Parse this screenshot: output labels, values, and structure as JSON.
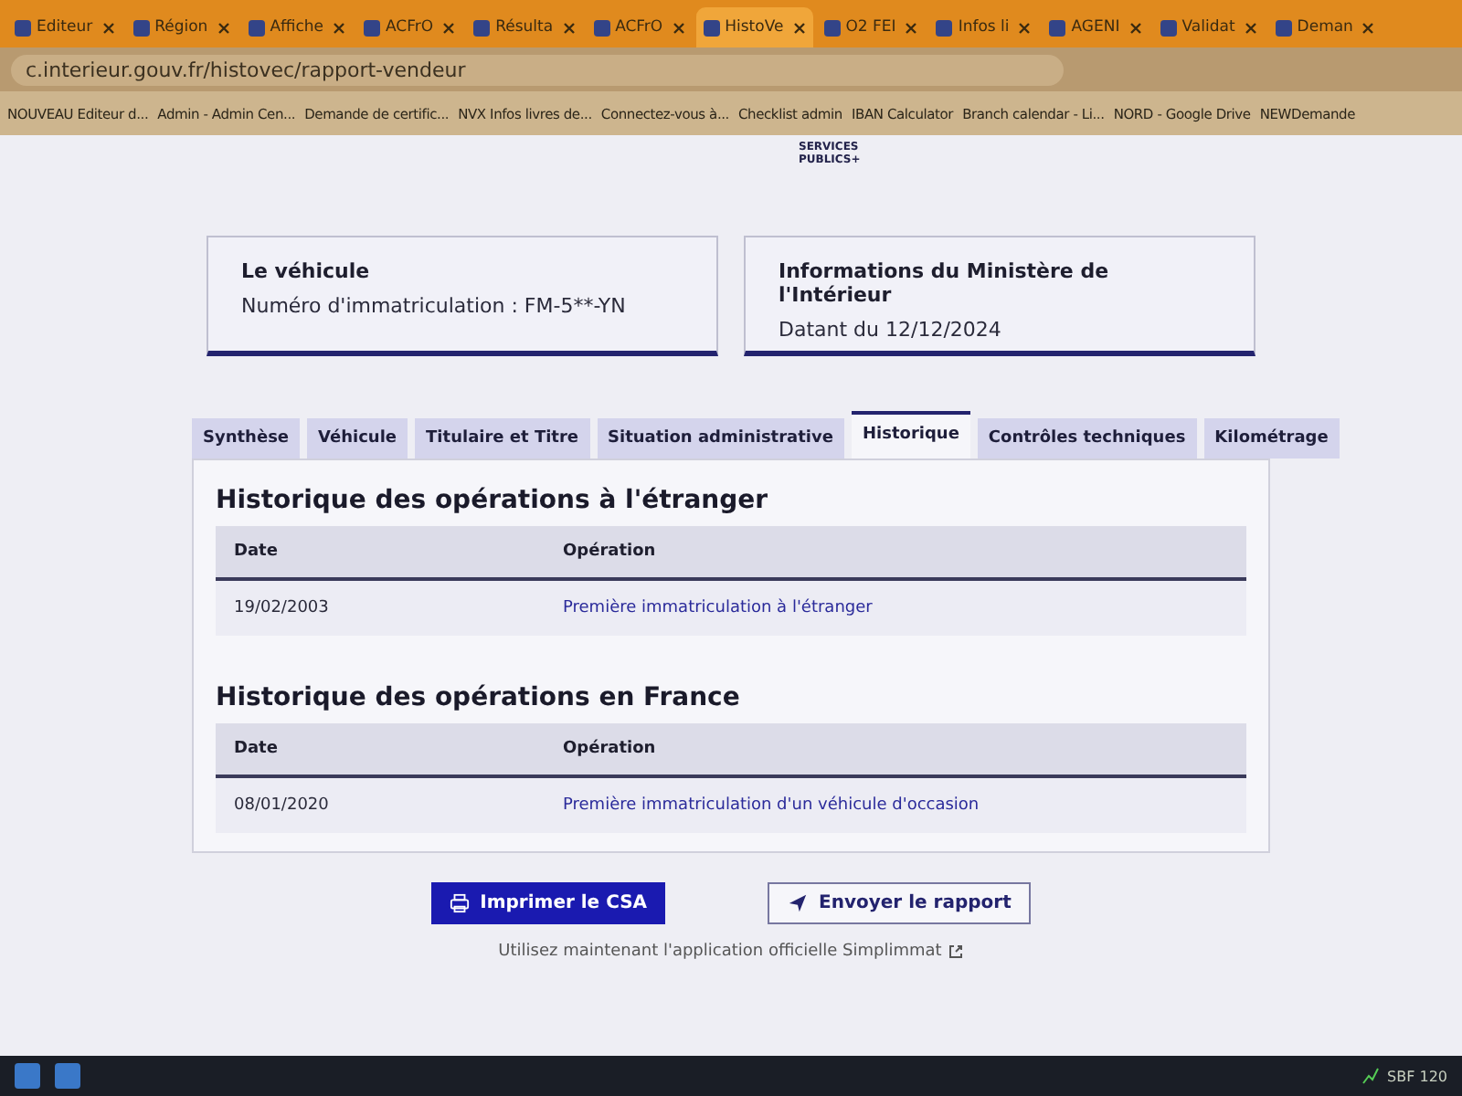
{
  "browser": {
    "tabs": [
      {
        "label": "Editeur",
        "selected": false
      },
      {
        "label": "Région",
        "selected": false
      },
      {
        "label": "Affiche",
        "selected": false
      },
      {
        "label": "ACFrO",
        "selected": false
      },
      {
        "label": "Résulta",
        "selected": false
      },
      {
        "label": "ACFrO",
        "selected": false
      },
      {
        "label": "HistoVe",
        "selected": true
      },
      {
        "label": "O2 FEI",
        "selected": false
      },
      {
        "label": "Infos li",
        "selected": false
      },
      {
        "label": "AGENI",
        "selected": false
      },
      {
        "label": "Validat",
        "selected": false
      },
      {
        "label": "Deman",
        "selected": false
      }
    ],
    "address": "c.interieur.gouv.fr/histovec/rapport-vendeur",
    "bookmarks": [
      "NOUVEAU Editeur d...",
      "Admin - Admin Cen...",
      "Demande de certific...",
      "NVX Infos livres de...",
      "Connectez-vous à...",
      "Checklist admin",
      "IBAN Calculator",
      "Branch calendar - Li...",
      "NORD - Google Drive",
      "NEWDemande"
    ]
  },
  "page": {
    "logo": "SERVICES PUBLICS+",
    "cards": [
      {
        "title": "Le véhicule",
        "text": "Numéro d'immatriculation : FM-5**-YN"
      },
      {
        "title": "Informations du Ministère de l'Intérieur",
        "text": "Datant du 12/12/2024"
      }
    ],
    "tabs": [
      {
        "label": "Synthèse",
        "selected": false
      },
      {
        "label": "Véhicule",
        "selected": false
      },
      {
        "label": "Titulaire et Titre",
        "selected": false
      },
      {
        "label": "Situation administrative",
        "selected": false
      },
      {
        "label": "Historique",
        "selected": true
      },
      {
        "label": "Contrôles techniques",
        "selected": false
      },
      {
        "label": "Kilométrage",
        "selected": false
      }
    ],
    "sections": [
      {
        "title": "Historique des opérations à l'étranger",
        "columns": [
          "Date",
          "Opération"
        ],
        "rows": [
          [
            "19/02/2003",
            "Première immatriculation à l'étranger"
          ]
        ]
      },
      {
        "title": "Historique des opérations en France",
        "columns": [
          "Date",
          "Opération"
        ],
        "rows": [
          [
            "08/01/2020",
            "Première immatriculation d'un véhicule d'occasion"
          ]
        ]
      }
    ],
    "buttons": [
      {
        "label": "Imprimer le CSA",
        "kind": "primary"
      },
      {
        "label": "Envoyer le rapport",
        "kind": "secondary"
      }
    ],
    "footer_link": "Utilisez maintenant l'application officielle Simplimmat"
  },
  "taskbar": {
    "ticker": "SBF 120"
  }
}
